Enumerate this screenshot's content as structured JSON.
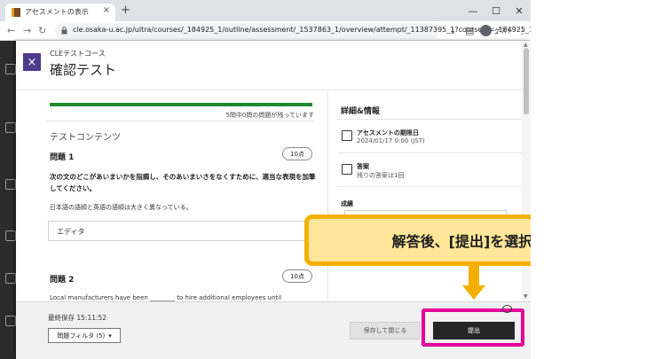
{
  "browser": {
    "tab_title": "アセスメントの表示",
    "new_tab": "+",
    "tab_close": "×",
    "window_min": "—",
    "window_max": "☐",
    "window_close": "✕",
    "url": "cle.osaka-u.ac.jp/ultra/courses/_184925_1/outline/assessment/_1537863_1/overview/attempt/_11387395_1?courseId=_184925_1",
    "profile_label": "ゲスト"
  },
  "header": {
    "course_name": "CLEテストコース",
    "page_title": "確認テスト",
    "close_label": "×"
  },
  "progress": {
    "fraction_complete": 1.0,
    "text": "5問中0問の問題が残っています"
  },
  "content": {
    "section_heading": "テストコンテンツ",
    "questions": [
      {
        "title": "問題 1",
        "points": "10点",
        "text": "次の文のどこがあいまいかを指摘し、そのあいまいさをなくすために、適当な表現を加筆してください。",
        "subtext": "日本語の語順と英語の語順は大きく異なっている。",
        "answer": "エディタ"
      },
      {
        "title": "問題 2",
        "points": "10点",
        "text": "Local manufacturers have been ________ to hire additional employees until"
      }
    ]
  },
  "info": {
    "heading": "詳細&情報",
    "due_label": "アセスメントの期限日",
    "due_value": "2024/01/17 0:00 (JST)",
    "attempts_label": "答案",
    "attempts_value": "残りの答案は1回",
    "grade_label": "成績"
  },
  "footer": {
    "last_saved": "最終保存 15:11:52",
    "filter_label": "問題フィルタ (5)",
    "save_close_label": "保存して閉じる",
    "submit_label": "提出"
  },
  "annotation": {
    "callout_text": "解答後、[提出]を選択する",
    "highlight_color": "#e6009b",
    "callout_fill": "#ffe699",
    "callout_border": "#f4b000"
  },
  "colors": {
    "progress": "#1c8b2e",
    "close_button": "#4e3a8a",
    "submit_button": "#262626"
  }
}
